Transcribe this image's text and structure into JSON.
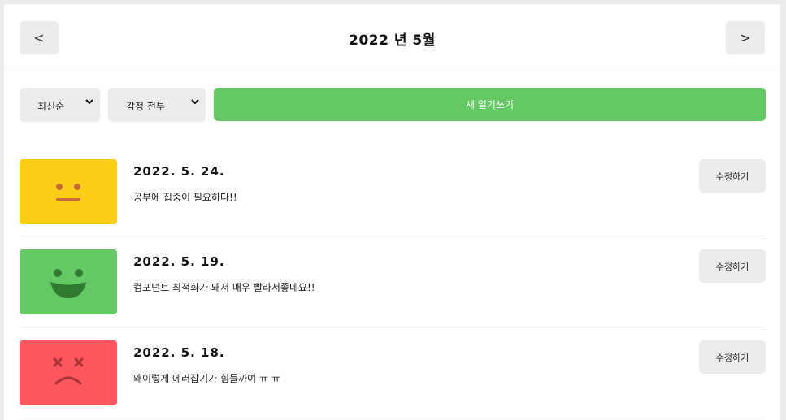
{
  "header": {
    "title": "2022 년 5월",
    "prev_label": "<",
    "next_label": ">"
  },
  "controls": {
    "order_select": {
      "selected": "최신순"
    },
    "emotion_select": {
      "selected": "감정 전부"
    },
    "new_button": "새 일기쓰기"
  },
  "colors": {
    "accent_green": "#64c964",
    "emotion_neutral": "#fdce17",
    "emotion_good": "#64c964",
    "emotion_bad": "#fd565f"
  },
  "diaries": [
    {
      "date": "2022. 5. 24.",
      "content": "공부에 집중이 필요하다!!",
      "emotion_icon": "neutral-face-icon",
      "emotion_color": "#fdce17",
      "edit_label": "수정하기"
    },
    {
      "date": "2022. 5. 19.",
      "content": "컴포넌트 최적화가 돼서 매우 빨라서좋네요!!",
      "emotion_icon": "happy-face-icon",
      "emotion_color": "#64c964",
      "edit_label": "수정하기"
    },
    {
      "date": "2022. 5. 18.",
      "content": "왜이렇게 에러잡기가 힘들까여 ㅠ ㅠ",
      "emotion_icon": "sad-face-icon",
      "emotion_color": "#fd565f",
      "edit_label": "수정하기"
    }
  ]
}
